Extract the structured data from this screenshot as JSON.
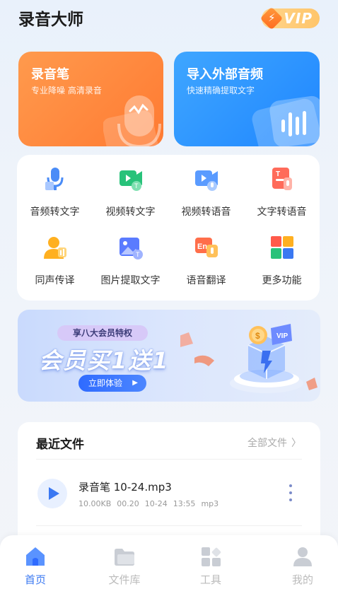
{
  "app": {
    "title": "录音大师",
    "vip_label": "VIP"
  },
  "hero_cards": [
    {
      "title": "录音笔",
      "subtitle": "专业降噪 高清录音",
      "color": "#ff8a3d"
    },
    {
      "title": "导入外部音频",
      "subtitle": "快速精确提取文字",
      "color": "#2b94ff"
    }
  ],
  "tools": [
    {
      "label": "音频转文字",
      "icon": "audio-to-text-icon"
    },
    {
      "label": "视频转文字",
      "icon": "video-to-text-icon"
    },
    {
      "label": "视频转语音",
      "icon": "video-to-speech-icon"
    },
    {
      "label": "文字转语音",
      "icon": "text-to-speech-icon"
    },
    {
      "label": "同声传译",
      "icon": "simultaneous-interpretation-icon"
    },
    {
      "label": "图片提取文字",
      "icon": "image-ocr-icon"
    },
    {
      "label": "语音翻译",
      "icon": "voice-translate-icon"
    },
    {
      "label": "更多功能",
      "icon": "more-features-icon"
    }
  ],
  "banner": {
    "tag": "享八大会员特权",
    "headline": "会员买1送1",
    "cta": "立即体验"
  },
  "recent": {
    "title": "最近文件",
    "all_files": "全部文件",
    "files": [
      {
        "name": "录音笔 10-24.mp3",
        "size": "10.00KB",
        "duration": "00.20",
        "date": "10-24",
        "time": "13:55",
        "format": "mp3"
      }
    ]
  },
  "tabbar": {
    "items": [
      {
        "label": "首页",
        "icon": "home-icon",
        "active": true
      },
      {
        "label": "文件库",
        "icon": "folder-icon",
        "active": false
      },
      {
        "label": "工具",
        "icon": "tools-icon",
        "active": false
      },
      {
        "label": "我的",
        "icon": "profile-icon",
        "active": false
      }
    ]
  },
  "colors": {
    "accent": "#3a78f2",
    "orange": "#ff8a3d",
    "blue": "#2b94ff",
    "vip_gold": "#ffc56a"
  }
}
